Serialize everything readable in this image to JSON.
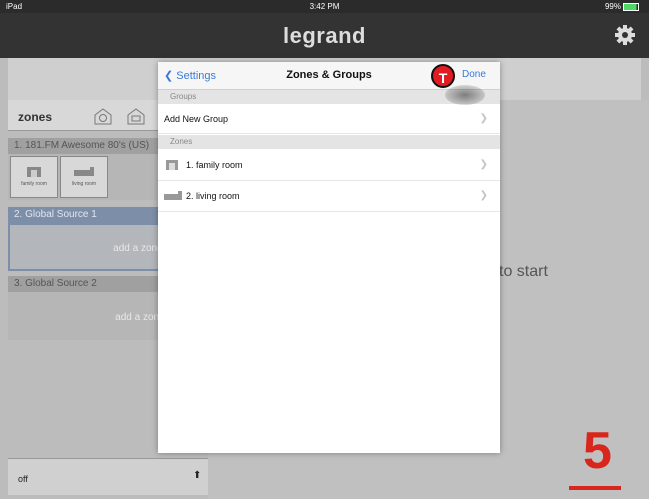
{
  "status": {
    "left": "iPad",
    "time": "3:42 PM",
    "battery": "99%"
  },
  "header": {
    "logo": "legrand"
  },
  "sidebar": {
    "zones_title": "zones",
    "sources": [
      {
        "name": "1. 181.FM Awesome 80's (US)",
        "zones": [
          "family room",
          "living room"
        ]
      },
      {
        "name": "2. Global Source 1",
        "placeholder": "add a zone to start"
      },
      {
        "name": "3. Global Source 2",
        "placeholder": "add a zone to start"
      }
    ],
    "footer_status": "off"
  },
  "main": {
    "background_text": "to start"
  },
  "modal": {
    "back_label": "Settings",
    "title": "Zones & Groups",
    "done_label": "Done",
    "badge": "T",
    "groups_header": "Groups",
    "add_group": "Add New Group",
    "zones_header": "Zones",
    "zones": [
      {
        "label": "1. family room"
      },
      {
        "label": "2. living room"
      }
    ]
  },
  "step_number": "5",
  "colors": {
    "accent_red": "#d9261c",
    "ios_blue": "#3a7bd5"
  }
}
